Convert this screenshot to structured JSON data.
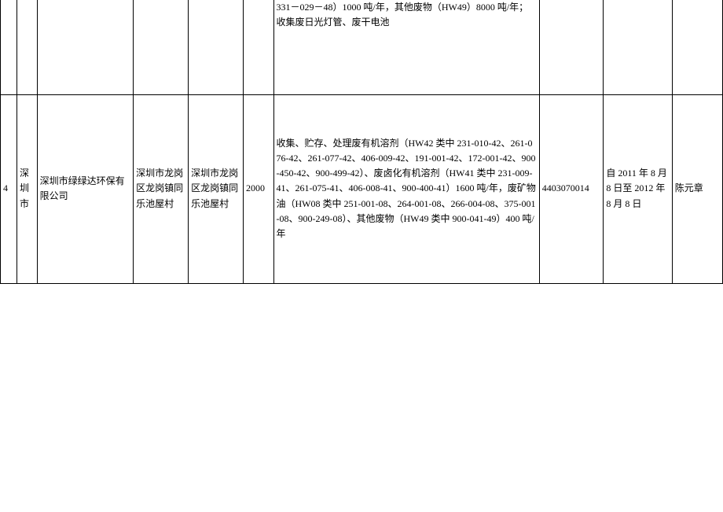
{
  "table": {
    "rows": [
      {
        "seq": "",
        "city": "",
        "company": "",
        "addr1": "",
        "addr2": "",
        "capacity": "",
        "scope": "331－029－48）1000 吨/年，其他废物（HW49）8000 吨/年；收集废日光灯管、废干电池",
        "license": "",
        "validity": "",
        "person": ""
      },
      {
        "seq": "4",
        "city": "深圳市",
        "company": "深圳市绿绿达环保有限公司",
        "addr1": "深圳市龙岗区龙岗镇同乐池屋村",
        "addr2": "深圳市龙岗区龙岗镇同乐池屋村",
        "capacity": "2000",
        "scope": "收集、贮存、处理废有机溶剂（HW42 类中 231-010-42、261-076-42、261-077-42、406-009-42、191-001-42、172-001-42、900-450-42、900-499-42）、废卤化有机溶剂（HW41 类中 231-009-41、261-075-41、406-008-41、900-400-41）1600 吨/年，废矿物油（HW08 类中 251-001-08、264-001-08、266-004-08、375-001-08、900-249-08）、其他废物（HW49 类中 900-041-49）400 吨/年",
        "license": "4403070014",
        "validity": "自 2011 年 8 月 8 日至 2012 年 8 月 8 日",
        "person": "陈元章"
      }
    ]
  }
}
